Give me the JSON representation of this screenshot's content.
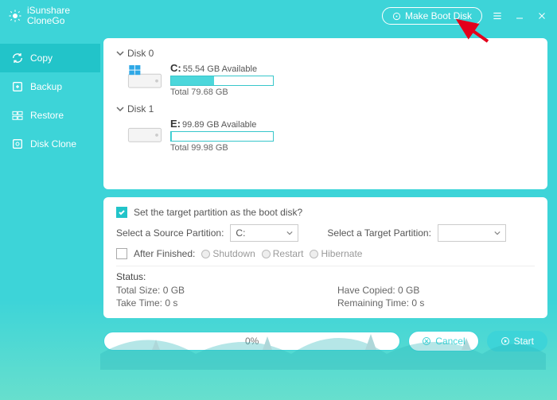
{
  "brand": {
    "line1": "iSunshare",
    "line2": "CloneGo"
  },
  "titlebar": {
    "make_boot": "Make Boot Disk"
  },
  "sidebar": {
    "items": [
      {
        "label": "Copy"
      },
      {
        "label": "Backup"
      },
      {
        "label": "Restore"
      },
      {
        "label": "Disk Clone"
      }
    ]
  },
  "disks": {
    "d0": {
      "name": "Disk 0",
      "letter": "C:",
      "avail": "55.54 GB Available",
      "total": "Total 79.68 GB",
      "fill": 42
    },
    "d1": {
      "name": "Disk 1",
      "letter": "E:",
      "avail": "99.89 GB Available",
      "total": "Total 99.98 GB",
      "fill": 1
    }
  },
  "opts": {
    "set_target": "Set the target partition as the boot disk?",
    "src_lbl": "Select a Source Partition:",
    "src_val": "C:",
    "tgt_lbl": "Select a Target Partition:",
    "tgt_val": "",
    "after": "After Finished:",
    "radios": {
      "a": "Shutdown",
      "b": "Restart",
      "c": "Hibernate"
    }
  },
  "status": {
    "head": "Status:",
    "total": "Total Size: 0 GB",
    "copied": "Have Copied: 0 GB",
    "take": "Take Time: 0 s",
    "remain": "Remaining Time: 0 s"
  },
  "bottom": {
    "progress": "0%",
    "cancel": "Cancel",
    "start": "Start"
  }
}
